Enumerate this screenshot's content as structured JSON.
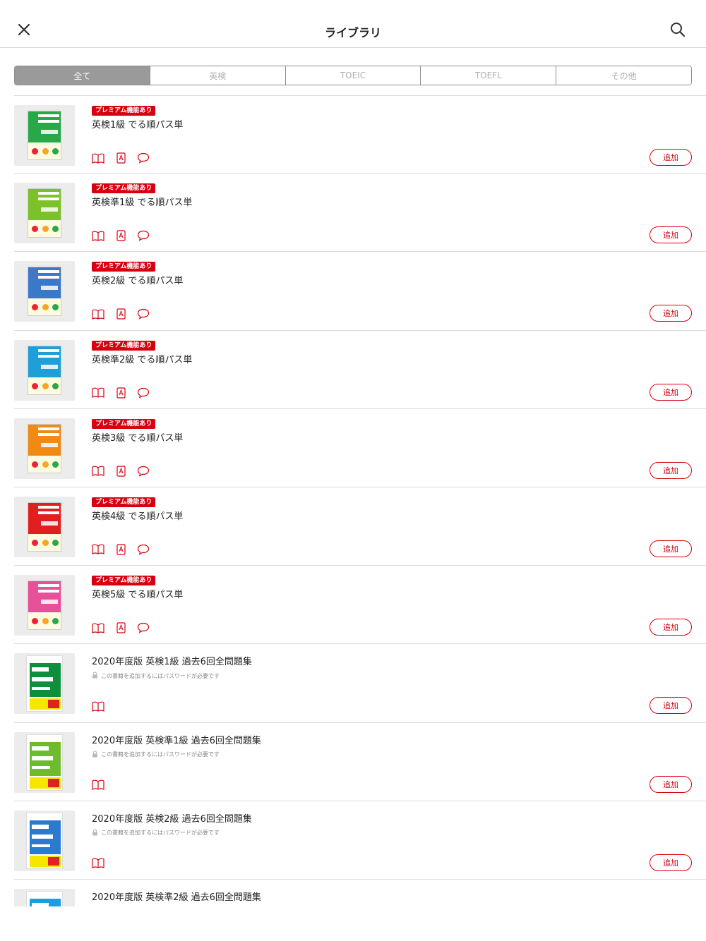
{
  "header": {
    "title": "ライブラリ",
    "close_icon": "close-icon",
    "search_icon": "search-icon"
  },
  "tabs": [
    {
      "label": "全て",
      "active": true
    },
    {
      "label": "英検",
      "active": false
    },
    {
      "label": "TOEIC",
      "active": false
    },
    {
      "label": "TOEFL",
      "active": false
    },
    {
      "label": "その他",
      "active": false
    }
  ],
  "colors": {
    "accent": "#d7000f",
    "tab_active_bg": "#9a9a9a"
  },
  "books": [
    {
      "title": "英検1級 でる順パス単",
      "badge": "プレミアム機能あり",
      "note": "",
      "icons": [
        "book-icon",
        "a-icon",
        "chat-icon"
      ],
      "add": "追加",
      "cover": "deru",
      "cover_color": "#29a84a"
    },
    {
      "title": "英検準1級 でる順パス単",
      "badge": "プレミアム機能あり",
      "note": "",
      "icons": [
        "book-icon",
        "a-icon",
        "chat-icon"
      ],
      "add": "追加",
      "cover": "deru",
      "cover_color": "#7cc02a"
    },
    {
      "title": "英検2級 でる順パス単",
      "badge": "プレミアム機能あり",
      "note": "",
      "icons": [
        "book-icon",
        "a-icon",
        "chat-icon"
      ],
      "add": "追加",
      "cover": "deru",
      "cover_color": "#3a78c9"
    },
    {
      "title": "英検準2級 でる順パス単",
      "badge": "プレミアム機能あり",
      "note": "",
      "icons": [
        "book-icon",
        "a-icon",
        "chat-icon"
      ],
      "add": "追加",
      "cover": "deru",
      "cover_color": "#1f9fd8"
    },
    {
      "title": "英検3級 でる順パス単",
      "badge": "プレミアム機能あり",
      "note": "",
      "icons": [
        "book-icon",
        "a-icon",
        "chat-icon"
      ],
      "add": "追加",
      "cover": "deru",
      "cover_color": "#f08a12"
    },
    {
      "title": "英検4級 でる順パス単",
      "badge": "プレミアム機能あり",
      "note": "",
      "icons": [
        "book-icon",
        "a-icon",
        "chat-icon"
      ],
      "add": "追加",
      "cover": "deru",
      "cover_color": "#e02020"
    },
    {
      "title": "英検5級 でる順パス単",
      "badge": "プレミアム機能あり",
      "note": "",
      "icons": [
        "book-icon",
        "a-icon",
        "chat-icon"
      ],
      "add": "追加",
      "cover": "deru",
      "cover_color": "#e8509a"
    },
    {
      "title": "2020年度版 英検1級 過去6回全問題集",
      "badge": "",
      "note": "この書籍を追加するにはパスワードが必要です",
      "icons": [
        "book-icon"
      ],
      "add": "追加",
      "cover": "kako",
      "cover_color": "#0f8e3c"
    },
    {
      "title": "2020年度版 英検準1級 過去6回全問題集",
      "badge": "",
      "note": "この書籍を追加するにはパスワードが必要です",
      "icons": [
        "book-icon"
      ],
      "add": "追加",
      "cover": "kako",
      "cover_color": "#6fbb2e"
    },
    {
      "title": "2020年度版 英検2級 過去6回全問題集",
      "badge": "",
      "note": "この書籍を追加するにはパスワードが必要です",
      "icons": [
        "book-icon"
      ],
      "add": "追加",
      "cover": "kako",
      "cover_color": "#2a7bd0"
    },
    {
      "title": "2020年度版 英検準2級 過去6回全問題集",
      "badge": "",
      "note": "",
      "icons": [],
      "add": "",
      "cover": "kako",
      "cover_color": "#1aa0dc"
    }
  ]
}
